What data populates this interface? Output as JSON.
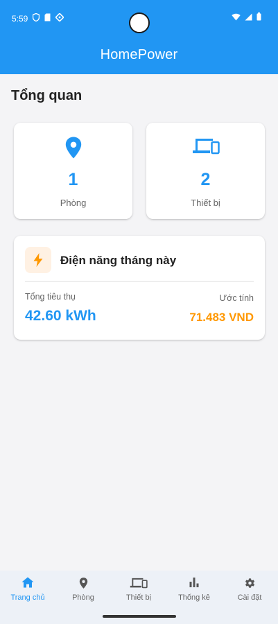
{
  "status_bar": {
    "time": "5:59"
  },
  "app_title": "HomePower",
  "overview": {
    "title": "Tổng quan",
    "rooms": {
      "count": "1",
      "label": "Phòng",
      "icon": "location-pin-icon"
    },
    "devices": {
      "count": "2",
      "label": "Thiết bị",
      "icon": "devices-icon"
    }
  },
  "energy": {
    "title": "Điện năng tháng này",
    "icon": "lightning-icon",
    "consumption_label": "Tổng tiêu thụ",
    "consumption_value": "42.60 kWh",
    "estimate_label": "Ước tính",
    "estimate_value": "71.483 VND"
  },
  "bottom_nav": {
    "items": [
      {
        "label": "Trang chủ",
        "icon": "home-icon",
        "active": true
      },
      {
        "label": "Phòng",
        "icon": "location-pin-icon",
        "active": false
      },
      {
        "label": "Thiết bị",
        "icon": "devices-icon",
        "active": false
      },
      {
        "label": "Thống kê",
        "icon": "bar-chart-icon",
        "active": false
      },
      {
        "label": "Cài đặt",
        "icon": "gear-icon",
        "active": false
      }
    ]
  },
  "colors": {
    "primary": "#2196f3",
    "accent_orange": "#ff9800",
    "background": "#f4f4f6",
    "nav_background": "#edf1f7"
  }
}
